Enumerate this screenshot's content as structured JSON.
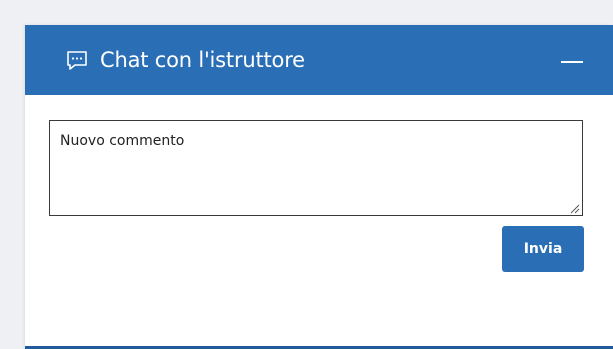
{
  "chat_panel": {
    "title": "Chat con l'istruttore",
    "header_icon": "chat-bubble-icon",
    "minimize_icon": "minimize-icon",
    "comment": {
      "placeholder": "Nuovo commento",
      "value": ""
    },
    "send_label": "Invia"
  },
  "colors": {
    "header_bg": "#2a6fb6",
    "button_bg": "#2a6fb6",
    "page_bg": "#eef0f3",
    "panel_bottom_border": "#1f5c9e"
  }
}
